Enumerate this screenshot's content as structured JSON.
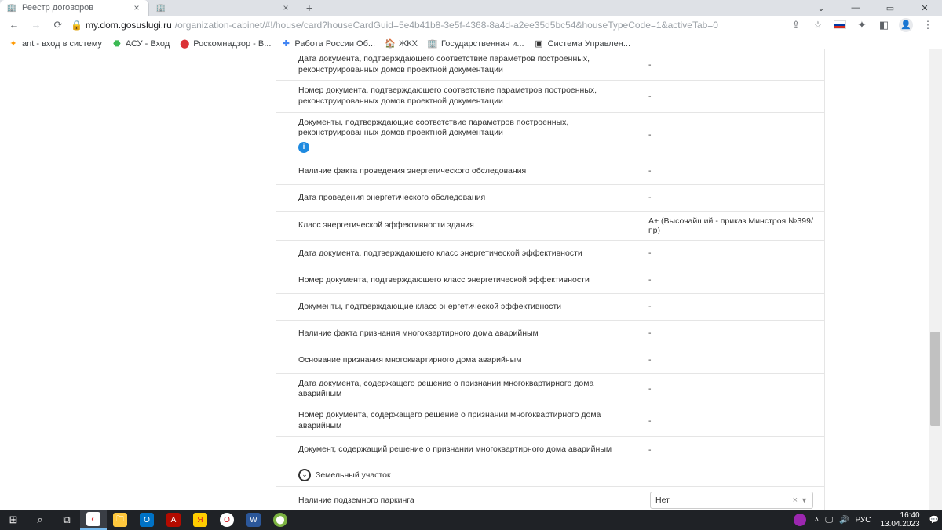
{
  "browser": {
    "tabs": [
      {
        "title": "Реестр договоров"
      },
      {
        "title": ""
      }
    ],
    "url_host": "my.dom.gosuslugi.ru",
    "url_path": "/organization-cabinet/#!/house/card?houseCardGuid=5e4b41b8-3e5f-4368-8a4d-a2ee35d5bc54&houseTypeCode=1&activeTab=0"
  },
  "bookmarks": [
    {
      "label": "ant - вход в систему",
      "color": "#ff9900"
    },
    {
      "label": "АСУ - Вход",
      "color": "#3cba54"
    },
    {
      "label": "Роскомнадзор - В...",
      "color": "#db3236"
    },
    {
      "label": "Работа России Об...",
      "color": "#4285f4"
    },
    {
      "label": "ЖКХ",
      "color": "#8e44ad"
    },
    {
      "label": "Государственная и...",
      "color": "#5a9fd4"
    },
    {
      "label": "Система Управлен...",
      "color": "#333"
    }
  ],
  "rows": [
    {
      "label": "Дата документа, подтверждающего соответствие параметров построенных, реконструированных домов проектной документации",
      "value": "-"
    },
    {
      "label": "Номер документа, подтверждающего соответствие параметров построенных, реконструированных домов проектной документации",
      "value": "-"
    },
    {
      "label": "Документы, подтверждающие соответствие параметров построенных, реконструированных домов проектной документации",
      "value": "-",
      "info": true
    },
    {
      "label": "Наличие факта проведения энергетического обследования",
      "value": "-"
    },
    {
      "label": "Дата проведения энергетического обследования",
      "value": "-"
    },
    {
      "label": "Класс энергетической эффективности здания",
      "value": "A+ (Высочайший - приказ Минстроя №399/пр)"
    },
    {
      "label": "Дата документа, подтверждающего класс энергетической эффективности",
      "value": "-"
    },
    {
      "label": "Номер документа, подтверждающего класс энергетической эффективности",
      "value": "-"
    },
    {
      "label": "Документы, подтверждающие класс энергетической эффективности",
      "value": "-"
    },
    {
      "label": "Наличие факта признания многоквартирного дома аварийным",
      "value": "-"
    },
    {
      "label": "Основание признания многоквартирного дома аварийным",
      "value": "-"
    },
    {
      "label": "Дата документа, содержащего решение о признании многоквартирного дома аварийным",
      "value": "-"
    },
    {
      "label": "Номер документа, содержащего решение о признании многоквартирного дома аварийным",
      "value": "-"
    },
    {
      "label": "Документ, содержащий решение о признании многоквартирного дома аварийным",
      "value": "-"
    }
  ],
  "section": {
    "title": "Земельный участок"
  },
  "parking_row": {
    "label": "Наличие подземного паркинга",
    "value": "Нет"
  },
  "tray": {
    "lang": "РУС",
    "time": "16:40",
    "date": "13.04.2023"
  }
}
